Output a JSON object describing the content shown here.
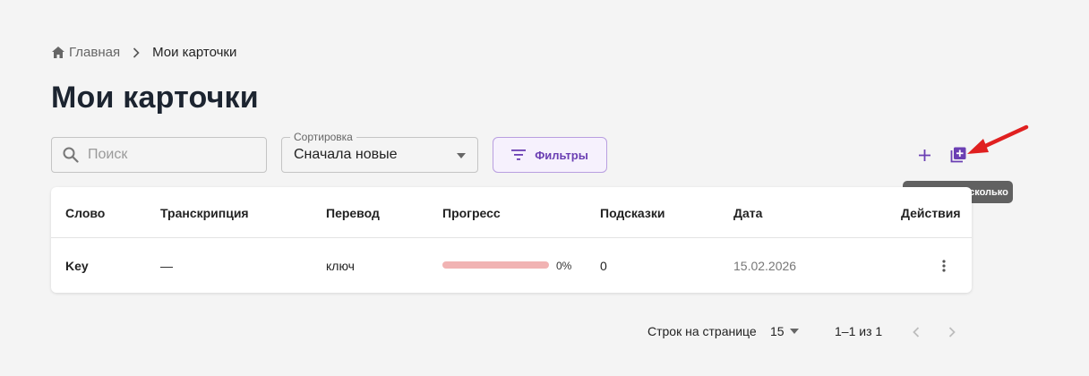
{
  "breadcrumb": {
    "home": "Главная",
    "current": "Мои карточки"
  },
  "page": {
    "title": "Мои карточки"
  },
  "search": {
    "placeholder": "Поиск",
    "value": ""
  },
  "sort": {
    "label": "Сортировка",
    "value": "Сначала новые"
  },
  "filters": {
    "label": "Фильтры"
  },
  "toolbar": {
    "add_icon": "plus-icon",
    "add_many_icon": "library-add-icon",
    "tooltip": "Добавить несколько"
  },
  "table": {
    "headers": [
      "Слово",
      "Транскрипция",
      "Перевод",
      "Прогресс",
      "Подсказки",
      "Дата",
      "Действия"
    ],
    "rows": [
      {
        "word": "Key",
        "transcription": "—",
        "translation": "ключ",
        "progress": 0,
        "progress_label": "0%",
        "hints": "0",
        "date": "15.02.2026"
      }
    ]
  },
  "pagination": {
    "rows_label": "Строк на странице",
    "rows_per_page": "15",
    "range": "1–1 из 1"
  },
  "colors": {
    "accent": "#6b3fb3",
    "annotation_arrow": "#e02020",
    "progress_track": "#f1b3b3",
    "tooltip_bg": "#616161"
  }
}
